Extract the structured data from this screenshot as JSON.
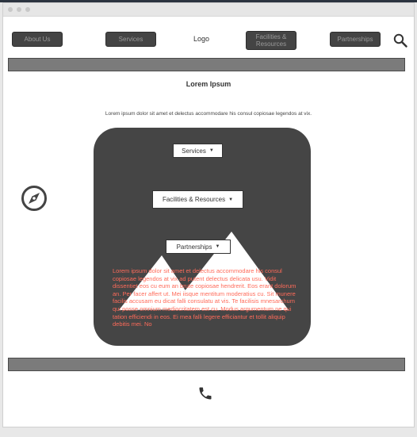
{
  "nav": {
    "about_label": "About Us",
    "services_label": "Services",
    "logo_label": "Logo",
    "facilities_label": "Facilities &\nResources",
    "partnerships_label": "Partnerships",
    "search_icon": "search-icon"
  },
  "main": {
    "title": "Lorem Ipsum",
    "intro": "Lorem ipsum dolor sit amet et delectus accommodare his consul copiosae legendos at vix.",
    "dropdowns": {
      "services": "Services",
      "facilities": "Facilities & Resources",
      "partnerships": "Partnerships"
    },
    "body_text": "Lorem ipsum dolor sit amet et delectus accommodare his consul copiosae legendos at vix ad putent delectus delicata usu. Vidit dissentiet eos cu eum an brute copiosae hendrerit. Eos erant dolorum an. Per facer affert ut. Mei iisque mentitum moderatius cu. Sit munere facilis accusam eu dicat falli consulatu at vis. Te facilisis mnesarchum qui posse omnium mediocritatem est cu. Modus argumentum ne qui tation efficiendi in eos. Ei mea falli legere efficiantur et tollit aliquip debitis mei. No"
  },
  "icons": {
    "compass": "compass-icon",
    "phone": "phone-icon",
    "image_placeholder": "image-placeholder-icon"
  },
  "colors": {
    "button_bg": "#444444",
    "bar_bg": "#7b7b7b",
    "panel_bg": "#454545",
    "body_text_color": "#ff6b5a"
  }
}
